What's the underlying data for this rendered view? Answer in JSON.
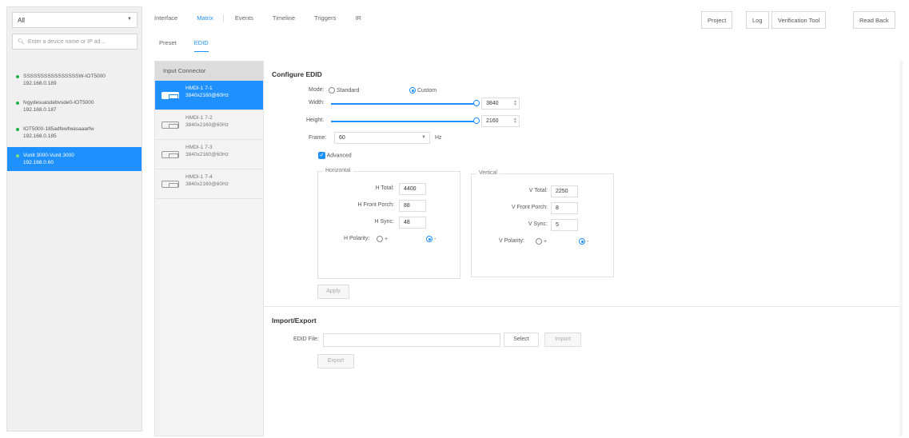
{
  "sidebar": {
    "dropdown_value": "All",
    "search_placeholder": "Enter a device name or IP ad...",
    "devices": [
      {
        "name": "SSSSSSSSSSSSSSSSW-IOT5000",
        "ip": "192.168.0.189"
      },
      {
        "name": "fvgydesuasdebvsde0-IOT5000",
        "ip": "192.168.0.187"
      },
      {
        "name": "IOT5000-185adfewfwasaaarfw",
        "ip": "192.168.0.185"
      },
      {
        "name": "Vunit 3000-Vunit 3000",
        "ip": "192.168.0.60"
      }
    ]
  },
  "nav": {
    "tabs": [
      "Interface",
      "Matrix",
      "Events",
      "Timeline",
      "Triggers",
      "IR"
    ],
    "active_tab": "Matrix",
    "buttons": [
      "Project",
      "Log",
      "Verification Tool",
      "Read Back"
    ]
  },
  "subtabs": [
    "Preset",
    "EDID"
  ],
  "connectors": {
    "header": "Input Connector",
    "items": [
      {
        "name": "HMDI-1 7-1",
        "res": "3840x2160@60Hz"
      },
      {
        "name": "HMDI-1 7-2",
        "res": "3840x2160@60Hz"
      },
      {
        "name": "HMDI-1 7-3",
        "res": "3840x2160@60Hz"
      },
      {
        "name": "HMDI-1 7-4",
        "res": "3840x2160@60Hz"
      }
    ]
  },
  "config": {
    "title": "Configure EDID",
    "mode_label": "Mode:",
    "mode_standard": "Standard",
    "mode_custom": "Custom",
    "width_label": "Width:",
    "width_value": "3840",
    "height_label": "Height:",
    "height_value": "2160",
    "frame_label": "Frame:",
    "frame_value": "60",
    "frame_unit": "Hz",
    "advanced_label": "Advanced",
    "horizontal": {
      "legend": "Horizontal",
      "total_label": "H Total:",
      "total": "4400",
      "porch_label": "H Front Porch:",
      "porch": "88",
      "sync_label": "H Sync:",
      "sync": "48",
      "polarity_label": "H Polarity:",
      "plus": "+",
      "minus": "-"
    },
    "vertical": {
      "legend": "Vertical",
      "total_label": "V Total:",
      "total": "2250",
      "porch_label": "V Front Porch:",
      "porch": "8",
      "sync_label": "V Sync:",
      "sync": "5",
      "polarity_label": "V Polarity:",
      "plus": "+",
      "minus": "-"
    },
    "apply_label": "Apply"
  },
  "import_export": {
    "title": "Import/Export",
    "file_label": "EDID File:",
    "select_label": "Select",
    "import_label": "Import",
    "export_label": "Export"
  },
  "colors": {
    "accent": "#1e90ff",
    "online": "#22b14c"
  }
}
